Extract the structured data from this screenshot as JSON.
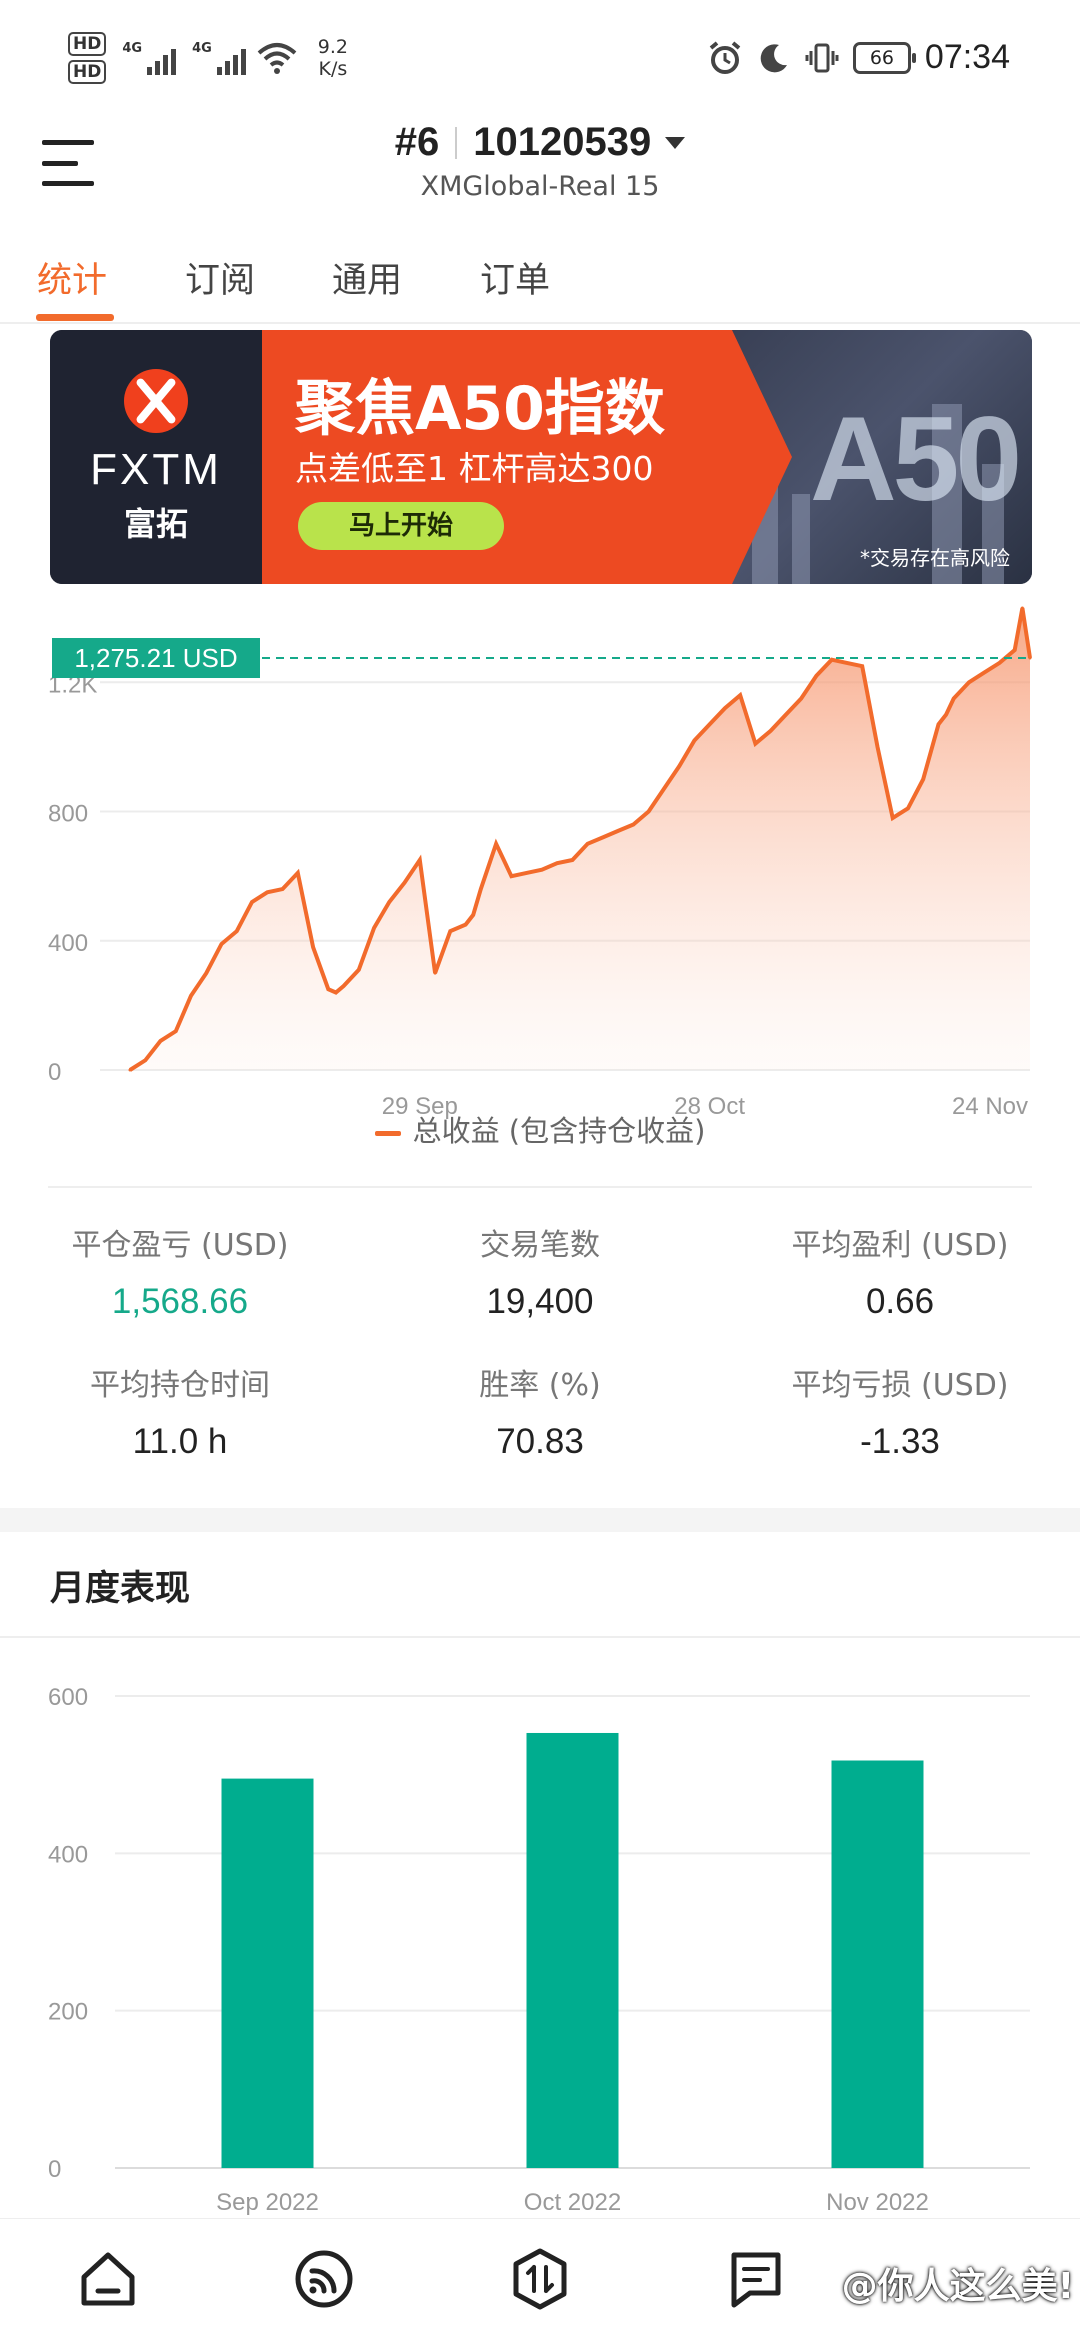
{
  "status_bar": {
    "hd1": "HD",
    "hd2": "HD",
    "net1": "4G",
    "net2": "4G",
    "speed_value": "9.2",
    "speed_unit": "K/s",
    "battery": "66",
    "time": "07:34",
    "icons": [
      "alarm-icon",
      "moon-icon",
      "vibrate-icon",
      "battery-icon"
    ]
  },
  "header": {
    "account_num": "#6",
    "account_id": "10120539",
    "server": "XMGlobal-Real 15"
  },
  "tabs": [
    {
      "label": "统计",
      "active": true
    },
    {
      "label": "订阅",
      "active": false
    },
    {
      "label": "通用",
      "active": false
    },
    {
      "label": "订单",
      "active": false
    }
  ],
  "banner": {
    "brand": "FXTM",
    "brand_cn": "富拓",
    "title": "聚焦A50指数",
    "subtitle": "点差低至1 杠杆高达300",
    "cta": "马上开始",
    "image_text": "A50",
    "risk_note": "*交易存在高风险",
    "colors": {
      "left": "#1f2331",
      "mid": "#ed4a22",
      "cta": "#b9e34b"
    }
  },
  "chart_data": [
    {
      "type": "area",
      "ylim": [
        0,
        1300
      ],
      "y_ticks": [
        "0",
        "400",
        "800",
        "1.2K"
      ],
      "x_ticks": [
        "29 Sep",
        "28 Oct",
        "24 Nov"
      ],
      "current_value_label": "1,275.21 USD",
      "current_value": 1275.21,
      "series": [
        {
          "name": "总收益 (包含持仓收益)",
          "color": "#f26b2c",
          "x_index": [
            0,
            2,
            4,
            6,
            8,
            10,
            12,
            14,
            16,
            18,
            20,
            22,
            24,
            26,
            27,
            28,
            30,
            32,
            34,
            36,
            38,
            40,
            42,
            44,
            45,
            46,
            48,
            50,
            52,
            54,
            56,
            58,
            60,
            62,
            64,
            66,
            68,
            70,
            72,
            74,
            76,
            78,
            80,
            82,
            84,
            86,
            88,
            90,
            92,
            94,
            96,
            98,
            100,
            102,
            104,
            106,
            107,
            108,
            110,
            112,
            114,
            116,
            117,
            118
          ],
          "values": [
            0,
            30,
            90,
            120,
            230,
            300,
            390,
            430,
            520,
            550,
            560,
            610,
            380,
            250,
            240,
            260,
            310,
            440,
            520,
            580,
            650,
            300,
            430,
            450,
            480,
            560,
            700,
            600,
            610,
            620,
            640,
            650,
            700,
            720,
            740,
            760,
            800,
            870,
            940,
            1020,
            1070,
            1120,
            1160,
            1010,
            1050,
            1100,
            1150,
            1220,
            1270,
            1260,
            1250,
            1000,
            780,
            810,
            900,
            1070,
            1100,
            1150,
            1200,
            1230,
            1260,
            1300,
            1430,
            1275.21
          ]
        }
      ],
      "legend": "总收益 (包含持仓收益)"
    },
    {
      "type": "bar",
      "title": "月度表现",
      "categories": [
        "Sep 2022",
        "Oct 2022",
        "Nov 2022"
      ],
      "values": [
        495,
        553,
        518
      ],
      "ylim": [
        0,
        600
      ],
      "y_ticks": [
        "0",
        "200",
        "400",
        "600"
      ],
      "color": "#00ad8f"
    }
  ],
  "stats": [
    {
      "label": "平仓盈亏 (USD)",
      "value": "1,568.66",
      "color": "#15a98a"
    },
    {
      "label": "交易笔数",
      "value": "19,400"
    },
    {
      "label": "平均盈利 (USD)",
      "value": "0.66"
    },
    {
      "label": "平均持仓时间",
      "value": "11.0 h"
    },
    {
      "label": "胜率 (%)",
      "value": "70.83"
    },
    {
      "label": "平均亏损 (USD)",
      "value": "-1.33"
    }
  ],
  "monthly": {
    "title": "月度表现"
  },
  "bottom_nav": {
    "items": [
      "home-icon",
      "signal-icon",
      "trade-icon",
      "news-icon"
    ],
    "watermark": "@你人这么美!"
  }
}
